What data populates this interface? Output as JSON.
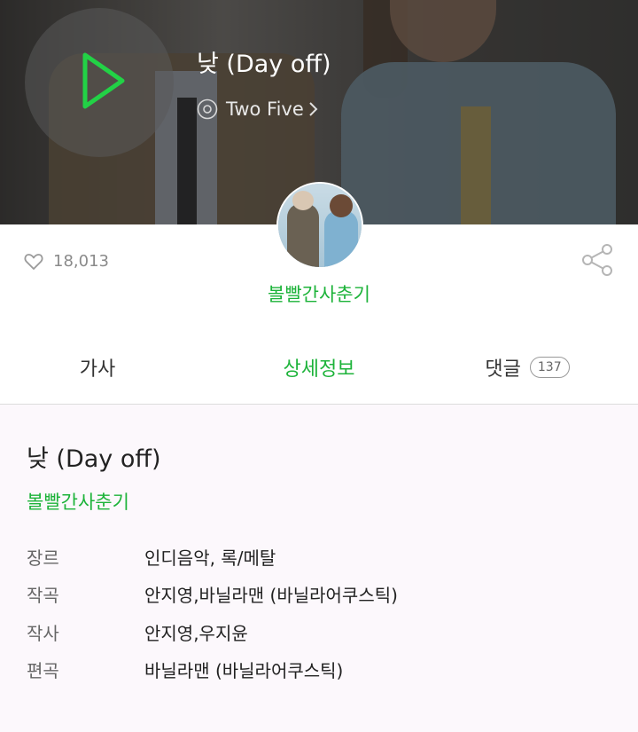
{
  "header": {
    "song_title": "낮 (Day off)",
    "album_name": "Two Five",
    "play_icon": "play-icon",
    "accent_color": "#1db33a"
  },
  "info": {
    "like_count": "18,013",
    "artist_name": "볼빨간사춘기"
  },
  "tabs": [
    {
      "label": "가사"
    },
    {
      "label": "상세정보",
      "active": true
    },
    {
      "label": "댓글",
      "badge": "137"
    }
  ],
  "details": {
    "title": "낮 (Day off)",
    "artist": "볼빨간사춘기",
    "rows": [
      {
        "label": "장르",
        "value": "인디음악, 록/메탈"
      },
      {
        "label": "작곡",
        "value": "안지영,바닐라맨 (바닐라어쿠스틱)"
      },
      {
        "label": "작사",
        "value": "안지영,우지윤"
      },
      {
        "label": "편곡",
        "value": "바닐라맨 (바닐라어쿠스틱)"
      }
    ]
  }
}
